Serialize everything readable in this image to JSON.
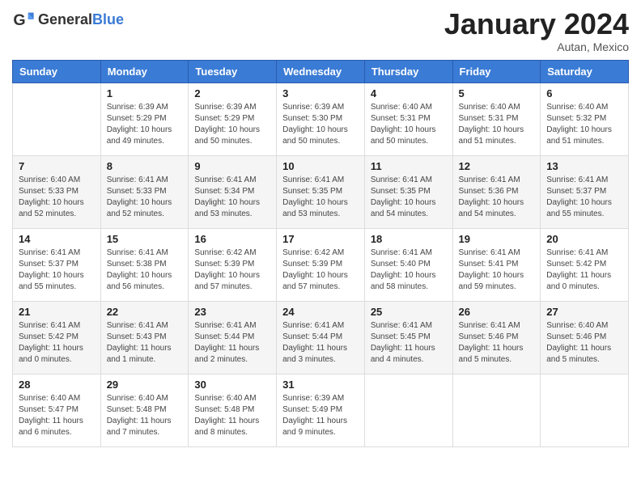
{
  "header": {
    "logo_general": "General",
    "logo_blue": "Blue",
    "month_title": "January 2024",
    "location": "Autan, Mexico"
  },
  "weekdays": [
    "Sunday",
    "Monday",
    "Tuesday",
    "Wednesday",
    "Thursday",
    "Friday",
    "Saturday"
  ],
  "weeks": [
    [
      {
        "day": "",
        "info": ""
      },
      {
        "day": "1",
        "info": "Sunrise: 6:39 AM\nSunset: 5:29 PM\nDaylight: 10 hours\nand 49 minutes."
      },
      {
        "day": "2",
        "info": "Sunrise: 6:39 AM\nSunset: 5:29 PM\nDaylight: 10 hours\nand 50 minutes."
      },
      {
        "day": "3",
        "info": "Sunrise: 6:39 AM\nSunset: 5:30 PM\nDaylight: 10 hours\nand 50 minutes."
      },
      {
        "day": "4",
        "info": "Sunrise: 6:40 AM\nSunset: 5:31 PM\nDaylight: 10 hours\nand 50 minutes."
      },
      {
        "day": "5",
        "info": "Sunrise: 6:40 AM\nSunset: 5:31 PM\nDaylight: 10 hours\nand 51 minutes."
      },
      {
        "day": "6",
        "info": "Sunrise: 6:40 AM\nSunset: 5:32 PM\nDaylight: 10 hours\nand 51 minutes."
      }
    ],
    [
      {
        "day": "7",
        "info": "Sunrise: 6:40 AM\nSunset: 5:33 PM\nDaylight: 10 hours\nand 52 minutes."
      },
      {
        "day": "8",
        "info": "Sunrise: 6:41 AM\nSunset: 5:33 PM\nDaylight: 10 hours\nand 52 minutes."
      },
      {
        "day": "9",
        "info": "Sunrise: 6:41 AM\nSunset: 5:34 PM\nDaylight: 10 hours\nand 53 minutes."
      },
      {
        "day": "10",
        "info": "Sunrise: 6:41 AM\nSunset: 5:35 PM\nDaylight: 10 hours\nand 53 minutes."
      },
      {
        "day": "11",
        "info": "Sunrise: 6:41 AM\nSunset: 5:35 PM\nDaylight: 10 hours\nand 54 minutes."
      },
      {
        "day": "12",
        "info": "Sunrise: 6:41 AM\nSunset: 5:36 PM\nDaylight: 10 hours\nand 54 minutes."
      },
      {
        "day": "13",
        "info": "Sunrise: 6:41 AM\nSunset: 5:37 PM\nDaylight: 10 hours\nand 55 minutes."
      }
    ],
    [
      {
        "day": "14",
        "info": "Sunrise: 6:41 AM\nSunset: 5:37 PM\nDaylight: 10 hours\nand 55 minutes."
      },
      {
        "day": "15",
        "info": "Sunrise: 6:41 AM\nSunset: 5:38 PM\nDaylight: 10 hours\nand 56 minutes."
      },
      {
        "day": "16",
        "info": "Sunrise: 6:42 AM\nSunset: 5:39 PM\nDaylight: 10 hours\nand 57 minutes."
      },
      {
        "day": "17",
        "info": "Sunrise: 6:42 AM\nSunset: 5:39 PM\nDaylight: 10 hours\nand 57 minutes."
      },
      {
        "day": "18",
        "info": "Sunrise: 6:41 AM\nSunset: 5:40 PM\nDaylight: 10 hours\nand 58 minutes."
      },
      {
        "day": "19",
        "info": "Sunrise: 6:41 AM\nSunset: 5:41 PM\nDaylight: 10 hours\nand 59 minutes."
      },
      {
        "day": "20",
        "info": "Sunrise: 6:41 AM\nSunset: 5:42 PM\nDaylight: 11 hours\nand 0 minutes."
      }
    ],
    [
      {
        "day": "21",
        "info": "Sunrise: 6:41 AM\nSunset: 5:42 PM\nDaylight: 11 hours\nand 0 minutes."
      },
      {
        "day": "22",
        "info": "Sunrise: 6:41 AM\nSunset: 5:43 PM\nDaylight: 11 hours\nand 1 minute."
      },
      {
        "day": "23",
        "info": "Sunrise: 6:41 AM\nSunset: 5:44 PM\nDaylight: 11 hours\nand 2 minutes."
      },
      {
        "day": "24",
        "info": "Sunrise: 6:41 AM\nSunset: 5:44 PM\nDaylight: 11 hours\nand 3 minutes."
      },
      {
        "day": "25",
        "info": "Sunrise: 6:41 AM\nSunset: 5:45 PM\nDaylight: 11 hours\nand 4 minutes."
      },
      {
        "day": "26",
        "info": "Sunrise: 6:41 AM\nSunset: 5:46 PM\nDaylight: 11 hours\nand 5 minutes."
      },
      {
        "day": "27",
        "info": "Sunrise: 6:40 AM\nSunset: 5:46 PM\nDaylight: 11 hours\nand 5 minutes."
      }
    ],
    [
      {
        "day": "28",
        "info": "Sunrise: 6:40 AM\nSunset: 5:47 PM\nDaylight: 11 hours\nand 6 minutes."
      },
      {
        "day": "29",
        "info": "Sunrise: 6:40 AM\nSunset: 5:48 PM\nDaylight: 11 hours\nand 7 minutes."
      },
      {
        "day": "30",
        "info": "Sunrise: 6:40 AM\nSunset: 5:48 PM\nDaylight: 11 hours\nand 8 minutes."
      },
      {
        "day": "31",
        "info": "Sunrise: 6:39 AM\nSunset: 5:49 PM\nDaylight: 11 hours\nand 9 minutes."
      },
      {
        "day": "",
        "info": ""
      },
      {
        "day": "",
        "info": ""
      },
      {
        "day": "",
        "info": ""
      }
    ]
  ]
}
